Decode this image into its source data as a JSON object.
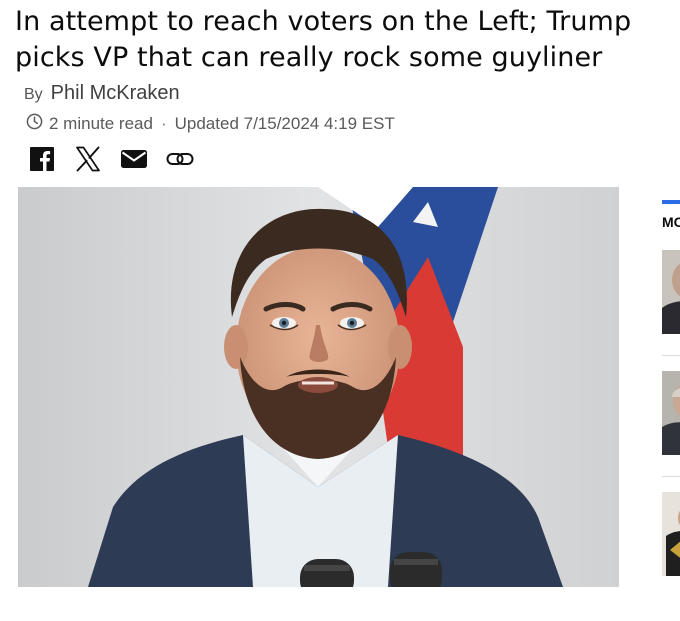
{
  "article": {
    "headline": "In attempt to reach voters on the Left; Trump picks VP that can really rock some guyliner",
    "byline_prefix": "By",
    "author": "Phil McKraken",
    "read_time": "2 minute read",
    "separator": "·",
    "updated": "Updated 7/15/2024 4:19 EST"
  },
  "share": {
    "icons": [
      "facebook-icon",
      "x-icon",
      "email-icon",
      "link-icon"
    ]
  },
  "rail": {
    "title": "MC"
  },
  "colors": {
    "accent": "#2d6be4",
    "flag_blue": "#2a4e9b",
    "flag_red": "#d93a33"
  }
}
